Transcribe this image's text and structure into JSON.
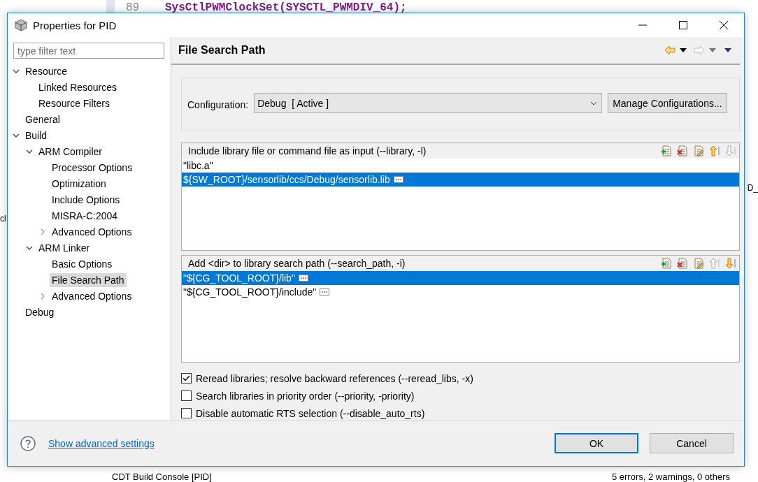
{
  "background_editor": {
    "line_number": "89",
    "code": "SysCtlPWMClockSet(SYSCTL_PWMDIV_64);",
    "fragment_left": "cl",
    "fragment_right": "D_",
    "console_title": "CDT Build Console [PID]",
    "problems_summary": "5 errors, 2 warnings, 0 others"
  },
  "window": {
    "title": "Properties for PID"
  },
  "filter": {
    "placeholder": "type filter text"
  },
  "tree": [
    {
      "label": "Resource",
      "expanded": true,
      "selected": false,
      "children": [
        {
          "label": "Linked Resources",
          "selected": false
        },
        {
          "label": "Resource Filters",
          "selected": false
        }
      ]
    },
    {
      "label": "General",
      "selected": false
    },
    {
      "label": "Build",
      "expanded": true,
      "selected": false,
      "children": [
        {
          "label": "ARM Compiler",
          "expanded": true,
          "selected": false,
          "children": [
            {
              "label": "Processor Options",
              "selected": false
            },
            {
              "label": "Optimization",
              "selected": false
            },
            {
              "label": "Include Options",
              "selected": false
            },
            {
              "label": "MISRA-C:2004",
              "selected": false
            },
            {
              "label": "Advanced Options",
              "expanded": false,
              "selected": false
            }
          ]
        },
        {
          "label": "ARM Linker",
          "expanded": true,
          "selected": false,
          "children": [
            {
              "label": "Basic Options",
              "selected": false
            },
            {
              "label": "File Search Path",
              "selected": true
            },
            {
              "label": "Advanced Options",
              "expanded": false,
              "selected": false
            }
          ]
        }
      ]
    },
    {
      "label": "Debug",
      "selected": false
    }
  ],
  "page": {
    "title": "File Search Path",
    "nav": [
      {
        "kind": "back",
        "disabled": false
      },
      {
        "kind": "back-menu",
        "disabled": false
      },
      {
        "kind": "forward",
        "disabled": true
      },
      {
        "kind": "forward-menu",
        "disabled": true
      },
      {
        "kind": "view-menu",
        "disabled": false
      }
    ]
  },
  "configuration": {
    "label": "Configuration:",
    "value": "Debug  [ Active ]",
    "manage_button": "Manage Configurations..."
  },
  "lists": [
    {
      "header": "Include library file or command file as input (--library, -l)",
      "tools": [
        {
          "kind": "add",
          "disabled": false
        },
        {
          "kind": "delete",
          "disabled": false
        },
        {
          "kind": "edit",
          "disabled": false
        },
        {
          "kind": "up",
          "disabled": false
        },
        {
          "kind": "down",
          "disabled": true
        }
      ],
      "items": [
        {
          "text": "\"libc.a\"",
          "selected": false,
          "more": false
        },
        {
          "text": "${SW_ROOT}/sensorlib/ccs/Debug/sensorlib.lib",
          "selected": true,
          "more": true
        }
      ]
    },
    {
      "header": "Add <dir> to library search path (--search_path, -i)",
      "tools": [
        {
          "kind": "add",
          "disabled": false
        },
        {
          "kind": "delete",
          "disabled": false
        },
        {
          "kind": "edit",
          "disabled": false
        },
        {
          "kind": "up",
          "disabled": true
        },
        {
          "kind": "down",
          "disabled": false
        }
      ],
      "items": [
        {
          "text": "\"${CG_TOOL_ROOT}/lib\"",
          "selected": true,
          "more": true
        },
        {
          "text": "\"${CG_TOOL_ROOT}/include\"",
          "selected": false,
          "more": true
        }
      ]
    }
  ],
  "options": [
    {
      "label": "Reread libraries; resolve backward references (--reread_libs, -x)",
      "checked": true
    },
    {
      "label": "Search libraries in priority order (--priority, -priority)",
      "checked": false
    },
    {
      "label": "Disable automatic RTS selection (--disable_auto_rts)",
      "checked": false
    }
  ],
  "footer": {
    "link": "Show advanced settings",
    "buttons": [
      {
        "label": "OK",
        "default": true
      },
      {
        "label": "Cancel",
        "default": false
      }
    ]
  }
}
